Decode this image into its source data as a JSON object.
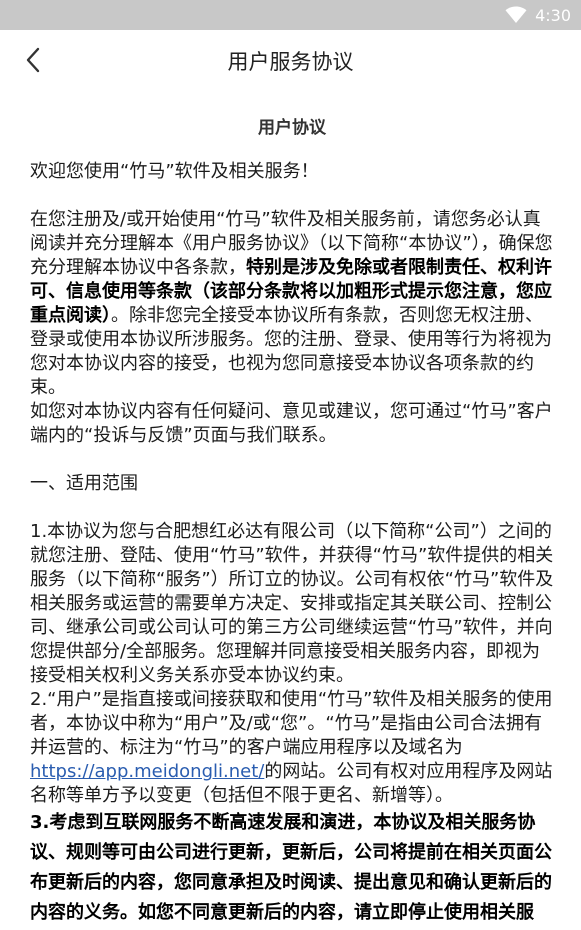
{
  "status_bar": {
    "time": "4:30",
    "icons": [
      "wifi-icon"
    ]
  },
  "app_bar": {
    "title": "用户服务协议",
    "back_icon": "chevron-left-icon"
  },
  "document": {
    "heading": "用户协议",
    "welcome": "欢迎您使用“竹马”软件及相关服务！",
    "intro_a": "在您注册及/或开始使用“竹马”软件及相关服务前，请您务必认真阅读并充分理解本《用户服务协议》（以下简称“本协议”），确保您充分理解本协议中各条款，",
    "intro_bold": "特别是涉及免除或者限制责任、权利许可、信息使用等条款（该部分条款将以加粗形式提示您注意，您应重点阅读）",
    "intro_b": "。除非您完全接受本协议所有条款，否则您无权注册、登录或使用本协议所涉服务。您的注册、登录、使用等行为将视为您对本协议内容的接受，也视为您同意接受本协议各项条款的约束。",
    "contact": "如您对本协议内容有任何疑问、意见或建议，您可通过“竹马”客户端内的“投诉与反馈”页面与我们联系。",
    "section_1_title": "一、适用范围",
    "clause_1": "1.本协议为您与合肥想红必达有限公司（以下简称“公司”）之间的就您注册、登陆、使用“竹马”软件，并获得“竹马”软件提供的相关服务（以下简称“服务”）所订立的协议。公司有权依“竹马”软件及相关服务或运营的需要单方决定、安排或指定其关联公司、控制公司、继承公司或公司认可的第三方公司继续运营“竹马”软件，并向您提供部分/全部服务。您理解并同意接受相关服务内容，即视为接受相关权利义务关系亦受本协议约束。",
    "clause_2_a": "2.“用户”是指直接或间接获取和使用“竹马”软件及相关服务的使用者，本协议中称为“用户”及/或“您”。“竹马”是指由公司合法拥有并运营的、标注为“竹马”的客户端应用程序以及域名为",
    "clause_2_link": "https://app.meidongli.net/",
    "clause_2_b": "的网站。公司有权对应用程序及网站名称等单方予以变更（包括但不限于更名、新增等）。",
    "clause_3": "3.考虑到互联网服务不断高速发展和演进，本协议及相关服务协议、规则等可由公司进行更新，更新后，公司将提前在相关页面公布更新后的内容，您同意承担及时阅读、提出意见和确认更新后的内容的义务。如您不同意更新后的内容，请立即停止使用相关服务。"
  }
}
